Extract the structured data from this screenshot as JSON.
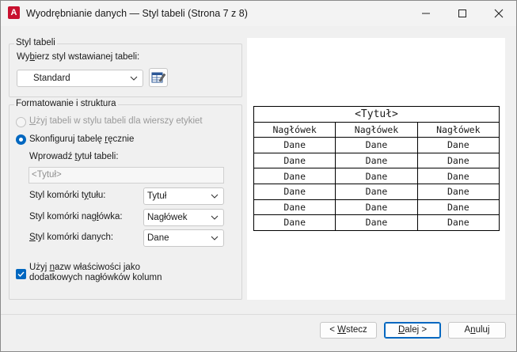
{
  "window": {
    "title": "Wyodrębnianie danych — Styl tabeli (Strona 7 z 8)",
    "app_icon_letter": "A",
    "controls": [
      "minimize-icon",
      "maximize-icon",
      "close-icon"
    ]
  },
  "table_style": {
    "group_label": "Styl tabeli",
    "select_label_pre": "Wy",
    "select_label_ul": "b",
    "select_label_post": "ierz styl wstawianej tabeli:",
    "selected": "Standard",
    "style_button_icon": "table-style-edit-icon"
  },
  "formatting": {
    "group_label": "Formatowanie i struktura",
    "radio_use_table_pre": "",
    "radio_use_table_ul": "U",
    "radio_use_table_post": "żyj tabeli w stylu tabeli dla wierszy etykiet",
    "radio_manual_pre": "Skonfiguruj tabelę ",
    "radio_manual_ul": "r",
    "radio_manual_post": "ęcznie",
    "title_label_pre": "Wprowadź ",
    "title_label_ul": "t",
    "title_label_post": "ytuł tabeli:",
    "title_placeholder": "<Tytuł>",
    "title_cell_label_pre": "Styl komórki t",
    "title_cell_label_ul": "y",
    "title_cell_label_post": "tułu:",
    "title_cell_value": "Tytuł",
    "header_cell_label_pre": "Styl komórki nag",
    "header_cell_label_ul": "ł",
    "header_cell_label_post": "ówka:",
    "header_cell_value": "Nagłówek",
    "data_cell_label_pre": "",
    "data_cell_label_ul": "S",
    "data_cell_label_post": "tyl komórki danych:",
    "data_cell_value": "Dane",
    "checkbox_line1_pre": "Użyj ",
    "checkbox_line1_ul": "n",
    "checkbox_line1_post": "azw właściwości jako",
    "checkbox_line2": "dodatkowych nagłówków kolumn",
    "checkbox_checked": true
  },
  "preview": {
    "title": "<Tytuł>",
    "headers": [
      "Nagłówek",
      "Nagłówek",
      "Nagłówek"
    ],
    "rows": [
      [
        "Dane",
        "Dane",
        "Dane"
      ],
      [
        "Dane",
        "Dane",
        "Dane"
      ],
      [
        "Dane",
        "Dane",
        "Dane"
      ],
      [
        "Dane",
        "Dane",
        "Dane"
      ],
      [
        "Dane",
        "Dane",
        "Dane"
      ],
      [
        "Dane",
        "Dane",
        "Dane"
      ]
    ]
  },
  "buttons": {
    "back_pre": "< ",
    "back_ul": "W",
    "back_post": "stecz",
    "next_ul": "D",
    "next_post": "alej >",
    "cancel_pre": "A",
    "cancel_ul": "n",
    "cancel_post": "uluj"
  },
  "colors": {
    "accent": "#0067c0",
    "app_icon": "#c8102e"
  }
}
